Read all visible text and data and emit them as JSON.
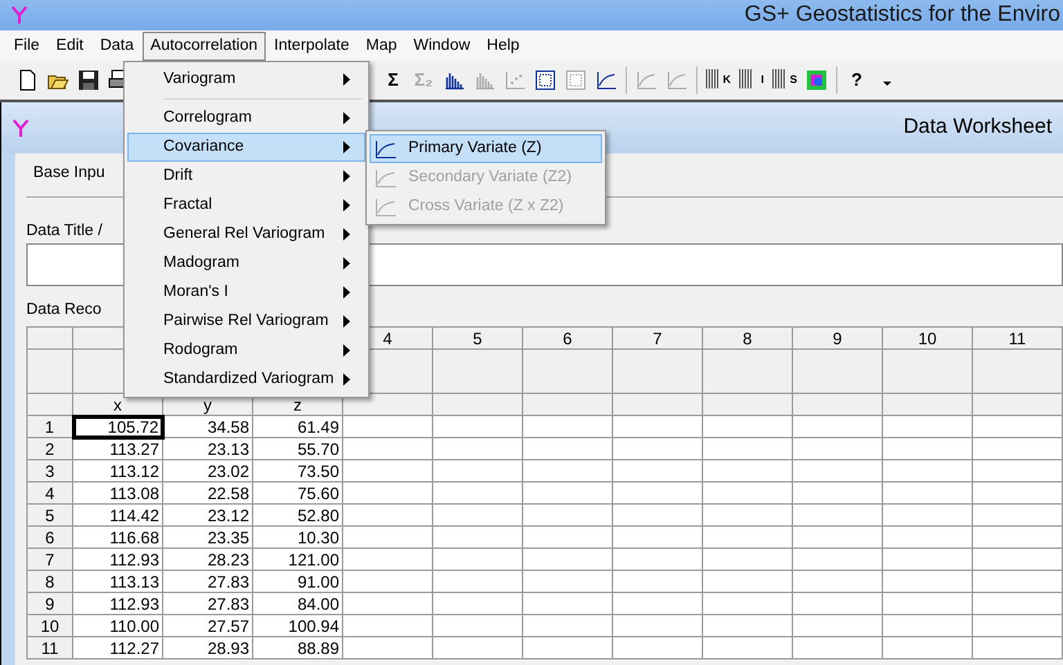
{
  "window": {
    "title": "GS+ Geostatistics for the Enviro"
  },
  "menu_bar": [
    {
      "label": "File",
      "selected": false
    },
    {
      "label": "Edit",
      "selected": false
    },
    {
      "label": "Data",
      "selected": false
    },
    {
      "label": "Autocorrelation",
      "selected": true
    },
    {
      "label": "Interpolate",
      "selected": false
    },
    {
      "label": "Map",
      "selected": false
    },
    {
      "label": "Window",
      "selected": false
    },
    {
      "label": "Help",
      "selected": false
    }
  ],
  "toolbar_left": [
    {
      "kind": "new"
    },
    {
      "kind": "open"
    },
    {
      "kind": "save"
    },
    {
      "kind": "print"
    }
  ],
  "toolbar_right": [
    {
      "kind": "glyph",
      "text": "Σ",
      "disabled": false
    },
    {
      "kind": "glyph",
      "text": "Σ₂",
      "disabled": true
    },
    {
      "kind": "histogram",
      "disabled": false
    },
    {
      "kind": "histogram",
      "disabled": true
    },
    {
      "kind": "scatter",
      "disabled": true
    },
    {
      "kind": "map",
      "disabled": false
    },
    {
      "kind": "map",
      "disabled": true
    },
    {
      "kind": "variogram",
      "disabled": false
    },
    {
      "kind": "separator"
    },
    {
      "kind": "variogram",
      "disabled": true
    },
    {
      "kind": "variogram",
      "disabled": true
    },
    {
      "kind": "separator"
    },
    {
      "kind": "dotgrid",
      "text": "K",
      "disabled": false
    },
    {
      "kind": "dotgrid",
      "text": "I",
      "disabled": false
    },
    {
      "kind": "dotgrid",
      "text": "S",
      "disabled": false
    },
    {
      "kind": "colormap"
    },
    {
      "kind": "separator"
    },
    {
      "kind": "glyph",
      "text": "?",
      "disabled": false
    },
    {
      "kind": "dropdown"
    }
  ],
  "worksheet": {
    "title": "Data Worksheet",
    "tab": "Base Inpu",
    "title_label": "Data Title /",
    "records_label": "Data Reco",
    "grid": {
      "columns": [
        {
          "sub_label": "x"
        },
        {
          "sub_label": "y"
        },
        {
          "sub_label": "z"
        },
        {
          "number": "4"
        },
        {
          "number": "5"
        },
        {
          "number": "6"
        },
        {
          "number": "7"
        },
        {
          "number": "8"
        },
        {
          "number": "9"
        },
        {
          "number": "10"
        },
        {
          "number": "11"
        }
      ],
      "rows": [
        {
          "number": "1",
          "cells": [
            {
              "text": "105.72",
              "selected": true
            },
            {
              "text": "34.58",
              "selected": false
            },
            {
              "text": "61.49",
              "selected": false
            }
          ]
        },
        {
          "number": "2",
          "cells": [
            {
              "text": "113.27",
              "selected": false
            },
            {
              "text": "23.13",
              "selected": false
            },
            {
              "text": "55.70",
              "selected": false
            }
          ]
        },
        {
          "number": "3",
          "cells": [
            {
              "text": "113.12",
              "selected": false
            },
            {
              "text": "23.02",
              "selected": false
            },
            {
              "text": "73.50",
              "selected": false
            }
          ]
        },
        {
          "number": "4",
          "cells": [
            {
              "text": "113.08",
              "selected": false
            },
            {
              "text": "22.58",
              "selected": false
            },
            {
              "text": "75.60",
              "selected": false
            }
          ]
        },
        {
          "number": "5",
          "cells": [
            {
              "text": "114.42",
              "selected": false
            },
            {
              "text": "23.12",
              "selected": false
            },
            {
              "text": "52.80",
              "selected": false
            }
          ]
        },
        {
          "number": "6",
          "cells": [
            {
              "text": "116.68",
              "selected": false
            },
            {
              "text": "23.35",
              "selected": false
            },
            {
              "text": "10.30",
              "selected": false
            }
          ]
        },
        {
          "number": "7",
          "cells": [
            {
              "text": "112.93",
              "selected": false
            },
            {
              "text": "28.23",
              "selected": false
            },
            {
              "text": "121.00",
              "selected": false
            }
          ]
        },
        {
          "number": "8",
          "cells": [
            {
              "text": "113.13",
              "selected": false
            },
            {
              "text": "27.83",
              "selected": false
            },
            {
              "text": "91.00",
              "selected": false
            }
          ]
        },
        {
          "number": "9",
          "cells": [
            {
              "text": "112.93",
              "selected": false
            },
            {
              "text": "27.83",
              "selected": false
            },
            {
              "text": "84.00",
              "selected": false
            }
          ]
        },
        {
          "number": "10",
          "cells": [
            {
              "text": "110.00",
              "selected": false
            },
            {
              "text": "27.57",
              "selected": false
            },
            {
              "text": "100.94",
              "selected": false
            }
          ]
        },
        {
          "number": "11",
          "cells": [
            {
              "text": "112.27",
              "selected": false
            },
            {
              "text": "28.93",
              "selected": false
            },
            {
              "text": "88.89",
              "selected": false
            }
          ]
        }
      ]
    }
  },
  "dropdown_menu": [
    {
      "label": "Variogram",
      "selected": false,
      "separator_after": true
    },
    {
      "label": "Correlogram",
      "selected": false
    },
    {
      "label": "Covariance",
      "selected": true
    },
    {
      "label": "Drift",
      "selected": false
    },
    {
      "label": "Fractal",
      "selected": false
    },
    {
      "label": "General Rel Variogram",
      "selected": false
    },
    {
      "label": "Madogram",
      "selected": false
    },
    {
      "label": "Moran's I",
      "selected": false
    },
    {
      "label": "Pairwise Rel Variogram",
      "selected": false
    },
    {
      "label": "Rodogram",
      "selected": false
    },
    {
      "label": "Standardized Variogram",
      "selected": false
    }
  ],
  "submenu": [
    {
      "label": "Primary Variate (Z)",
      "selected": true,
      "disabled": false
    },
    {
      "label": "Secondary Variate (Z2)",
      "selected": false,
      "disabled": true
    },
    {
      "label": "Cross Variate (Z x Z2)",
      "selected": false,
      "disabled": true
    }
  ]
}
